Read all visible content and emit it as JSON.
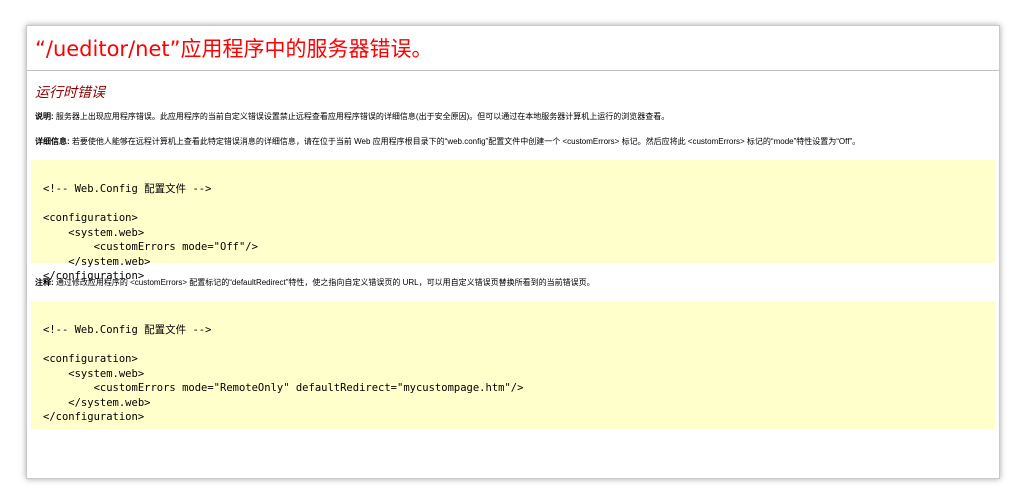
{
  "page": {
    "title": "“/ueditor/net”应用程序中的服务器错误。",
    "subtitle": "运行时错误",
    "description_label": "说明:",
    "description_text": "服务器上出现应用程序错误。此应用程序的当前自定义错误设置禁止远程查看应用程序错误的详细信息(出于安全原因)。但可以通过在本地服务器计算机上运行的浏览器查看。",
    "details_label": "详细信息:",
    "details_text": "若要使他人能够在远程计算机上查看此特定错误消息的详细信息，请在位于当前 Web 应用程序根目录下的“web.config”配置文件中创建一个 <customErrors> 标记。然后应将此 <customErrors> 标记的“mode”特性设置为“Off”。",
    "code1": {
      "comment_prefix": "<!-- Web.Config ",
      "comment_cn": "配置文件",
      "comment_suffix": " -->",
      "lines": [
        "<configuration>",
        "    <system.web>",
        "        <customErrors mode=\"Off\"/>",
        "    </system.web>",
        "</configuration>"
      ]
    },
    "note_label": "注释:",
    "note_text": "通过修改应用程序的 <customErrors> 配置标记的“defaultRedirect”特性，使之指向自定义错误页的 URL，可以用自定义错误页替换所看到的当前错误页。",
    "code2": {
      "comment_prefix": "<!-- Web.Config ",
      "comment_cn": "配置文件",
      "comment_suffix": " -->",
      "lines": [
        "<configuration>",
        "    <system.web>",
        "        <customErrors mode=\"RemoteOnly\" defaultRedirect=\"mycustompage.htm\"/>",
        "    </system.web>",
        "</configuration>"
      ]
    }
  }
}
